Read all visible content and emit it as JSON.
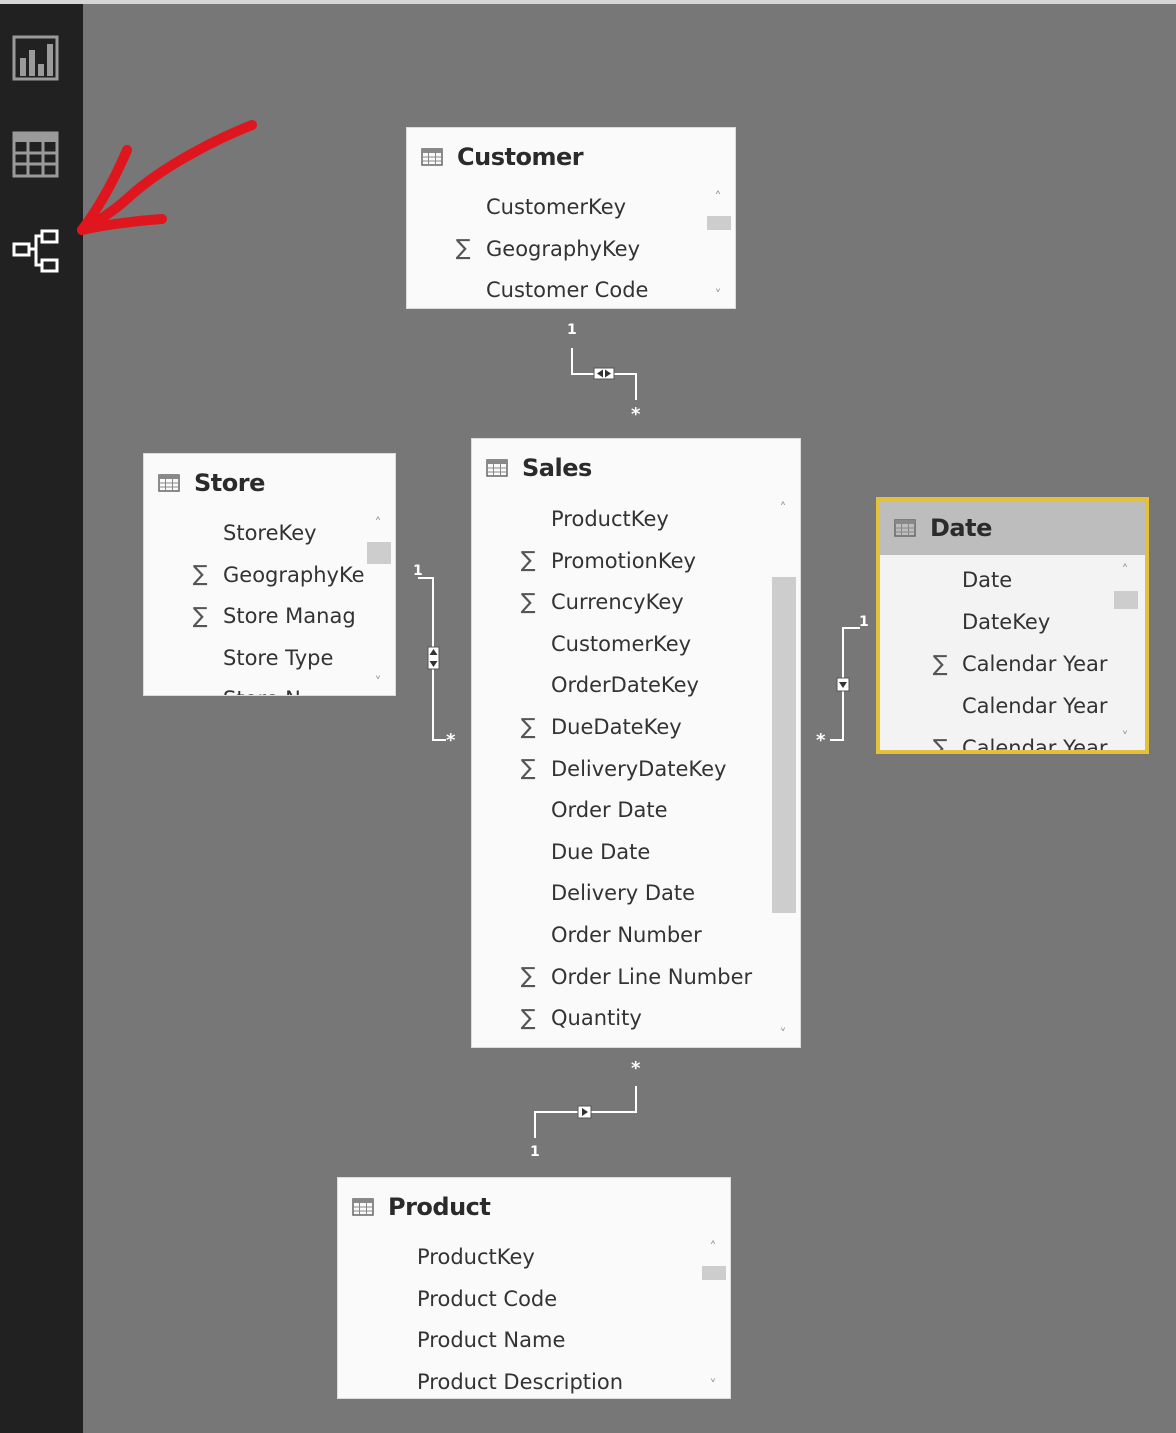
{
  "sidebar": {
    "items": [
      {
        "name": "report-view-icon"
      },
      {
        "name": "data-view-icon"
      },
      {
        "name": "relationships-view-icon",
        "active": true
      }
    ]
  },
  "tables": {
    "customer": {
      "title": "Customer",
      "fields": [
        {
          "name": "CustomerKey",
          "sigma": false
        },
        {
          "name": "GeographyKey",
          "sigma": true
        },
        {
          "name": "Customer Code",
          "sigma": false
        }
      ]
    },
    "store": {
      "title": "Store",
      "fields": [
        {
          "name": "StoreKey",
          "sigma": false
        },
        {
          "name": "GeographyKe",
          "sigma": true
        },
        {
          "name": "Store Manag",
          "sigma": true
        },
        {
          "name": "Store Type",
          "sigma": false
        },
        {
          "name": "Store N",
          "sigma": false
        }
      ]
    },
    "sales": {
      "title": "Sales",
      "fields": [
        {
          "name": "ProductKey",
          "sigma": false
        },
        {
          "name": "PromotionKey",
          "sigma": true
        },
        {
          "name": "CurrencyKey",
          "sigma": true
        },
        {
          "name": "CustomerKey",
          "sigma": false
        },
        {
          "name": "OrderDateKey",
          "sigma": false
        },
        {
          "name": "DueDateKey",
          "sigma": true
        },
        {
          "name": "DeliveryDateKey",
          "sigma": true
        },
        {
          "name": "Order Date",
          "sigma": false
        },
        {
          "name": "Due Date",
          "sigma": false
        },
        {
          "name": "Delivery Date",
          "sigma": false
        },
        {
          "name": "Order Number",
          "sigma": false
        },
        {
          "name": "Order Line Number",
          "sigma": true
        },
        {
          "name": "Quantity",
          "sigma": true
        }
      ]
    },
    "date": {
      "title": "Date",
      "selected": true,
      "fields": [
        {
          "name": "Date",
          "sigma": false
        },
        {
          "name": "DateKey",
          "sigma": false
        },
        {
          "name": "Calendar Year",
          "sigma": true
        },
        {
          "name": "Calendar Year",
          "sigma": false
        },
        {
          "name": "Calendar Year",
          "sigma": true
        }
      ]
    },
    "product": {
      "title": "Product",
      "fields": [
        {
          "name": "ProductKey",
          "sigma": false
        },
        {
          "name": "Product Code",
          "sigma": false
        },
        {
          "name": "Product Name",
          "sigma": false
        },
        {
          "name": "Product Description",
          "sigma": false
        }
      ]
    }
  },
  "relationships": [
    {
      "from": "customer",
      "to": "sales",
      "one": "1",
      "many": "*",
      "filter": "both"
    },
    {
      "from": "store",
      "to": "sales",
      "one": "1",
      "many": "*",
      "filter": "both"
    },
    {
      "from": "date",
      "to": "sales",
      "one": "1",
      "many": "*",
      "filter": "single"
    },
    {
      "from": "product",
      "to": "sales",
      "one": "1",
      "many": "*",
      "filter": "single"
    }
  ],
  "colors": {
    "canvas": "#777777",
    "sidebar": "#212121",
    "card": "#fafafa",
    "selected_border": "#e3c13b",
    "annotation": "#e0161e",
    "sigma": "#555555"
  }
}
